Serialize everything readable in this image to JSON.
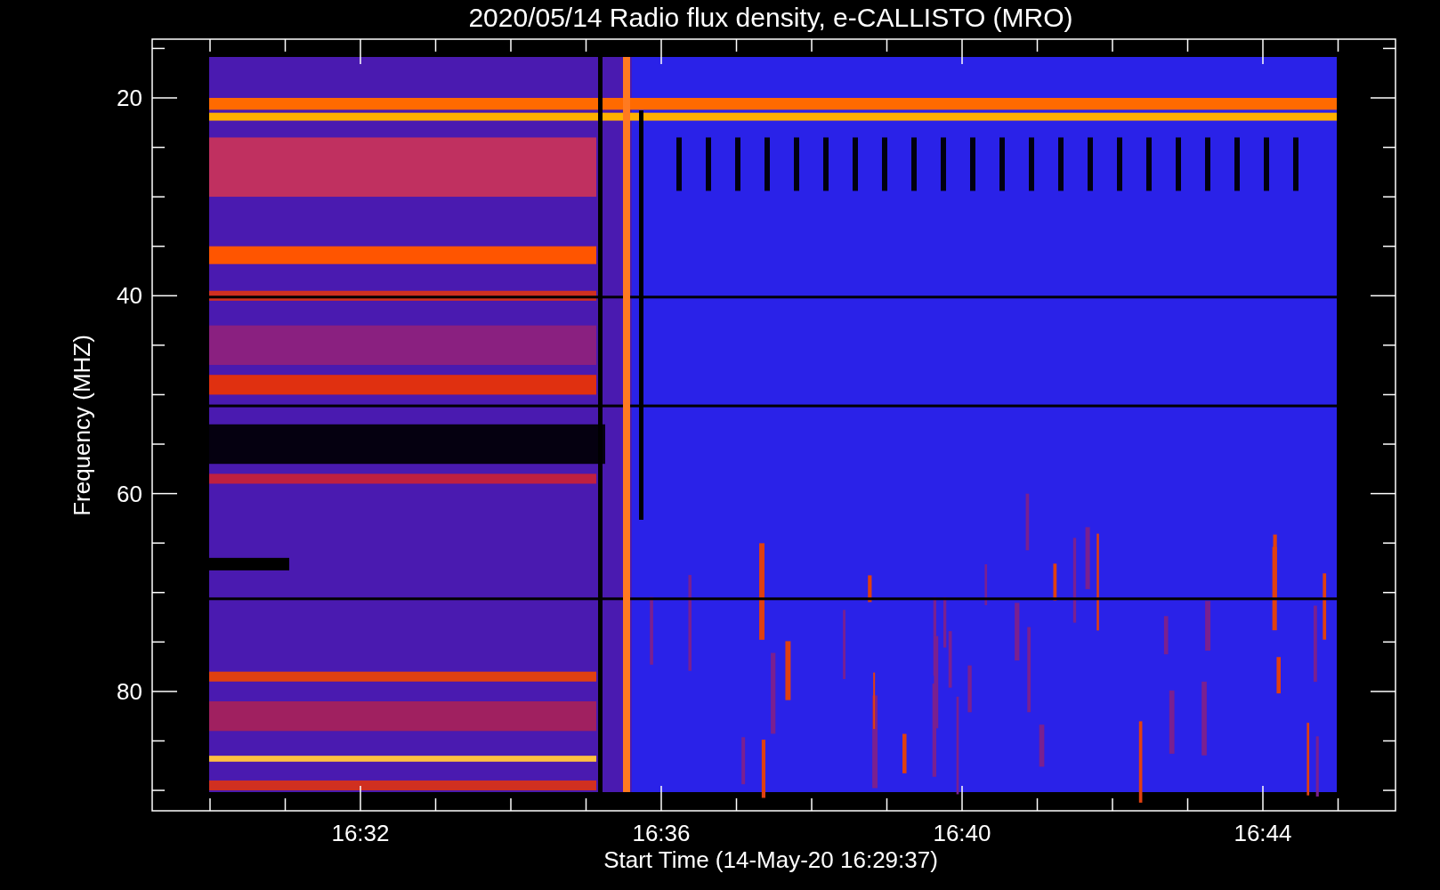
{
  "title": "2020/05/14  Radio flux density, e-CALLISTO (MRO)",
  "y_axis": {
    "label": "Frequency (MHZ)",
    "ticks": [
      "20",
      "40",
      "60",
      "80"
    ]
  },
  "x_axis": {
    "label": "Start Time (14-May-20 16:29:37)",
    "ticks": [
      "16:32",
      "16:36",
      "16:40",
      "16:44"
    ]
  }
}
